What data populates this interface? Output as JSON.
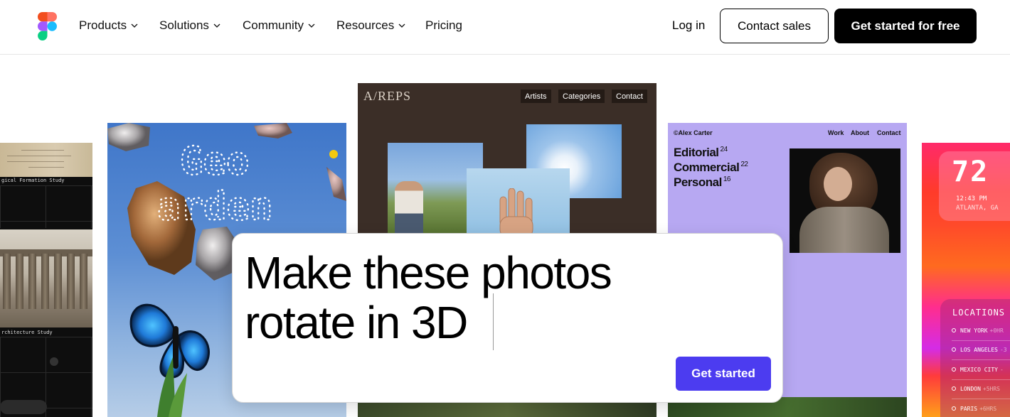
{
  "nav": {
    "products": "Products",
    "solutions": "Solutions",
    "community": "Community",
    "resources": "Resources",
    "pricing": "Pricing",
    "login": "Log in",
    "contact_sales": "Contact sales",
    "get_started_free": "Get started for free"
  },
  "cards": {
    "archive": {
      "label_1": "gical Formation Study",
      "label_2": "rchitecture Study"
    },
    "geo": {
      "title_1": "Geo",
      "title_2": "arden"
    },
    "areps": {
      "brand": "A/REPS",
      "menu": [
        "Artists",
        "Categories",
        "Contact"
      ]
    },
    "alex": {
      "name": "©Alex Carter",
      "menu": [
        "Work",
        "About",
        "Contact"
      ],
      "categories": [
        {
          "label": "Editorial",
          "count": "24"
        },
        {
          "label": "Commercial",
          "count": "22"
        },
        {
          "label": "Personal",
          "count": "16"
        }
      ]
    },
    "weather": {
      "temp": "72",
      "time": "12:43 PM",
      "city": "ATLANTA, GA",
      "locations_title": "LOCATIONS",
      "locations": [
        {
          "city": "NEW YORK",
          "offset": "+0HR"
        },
        {
          "city": "LOS ANGELES",
          "offset": "-3"
        },
        {
          "city": "MEXICO CITY",
          "offset": "-"
        },
        {
          "city": "LONDON",
          "offset": "+5HRS"
        },
        {
          "city": "PARIS",
          "offset": "+6HRS"
        }
      ]
    }
  },
  "prompt": {
    "text": "Make these photos rotate in 3D",
    "button": "Get started",
    "accent": "#4c3cf0"
  }
}
